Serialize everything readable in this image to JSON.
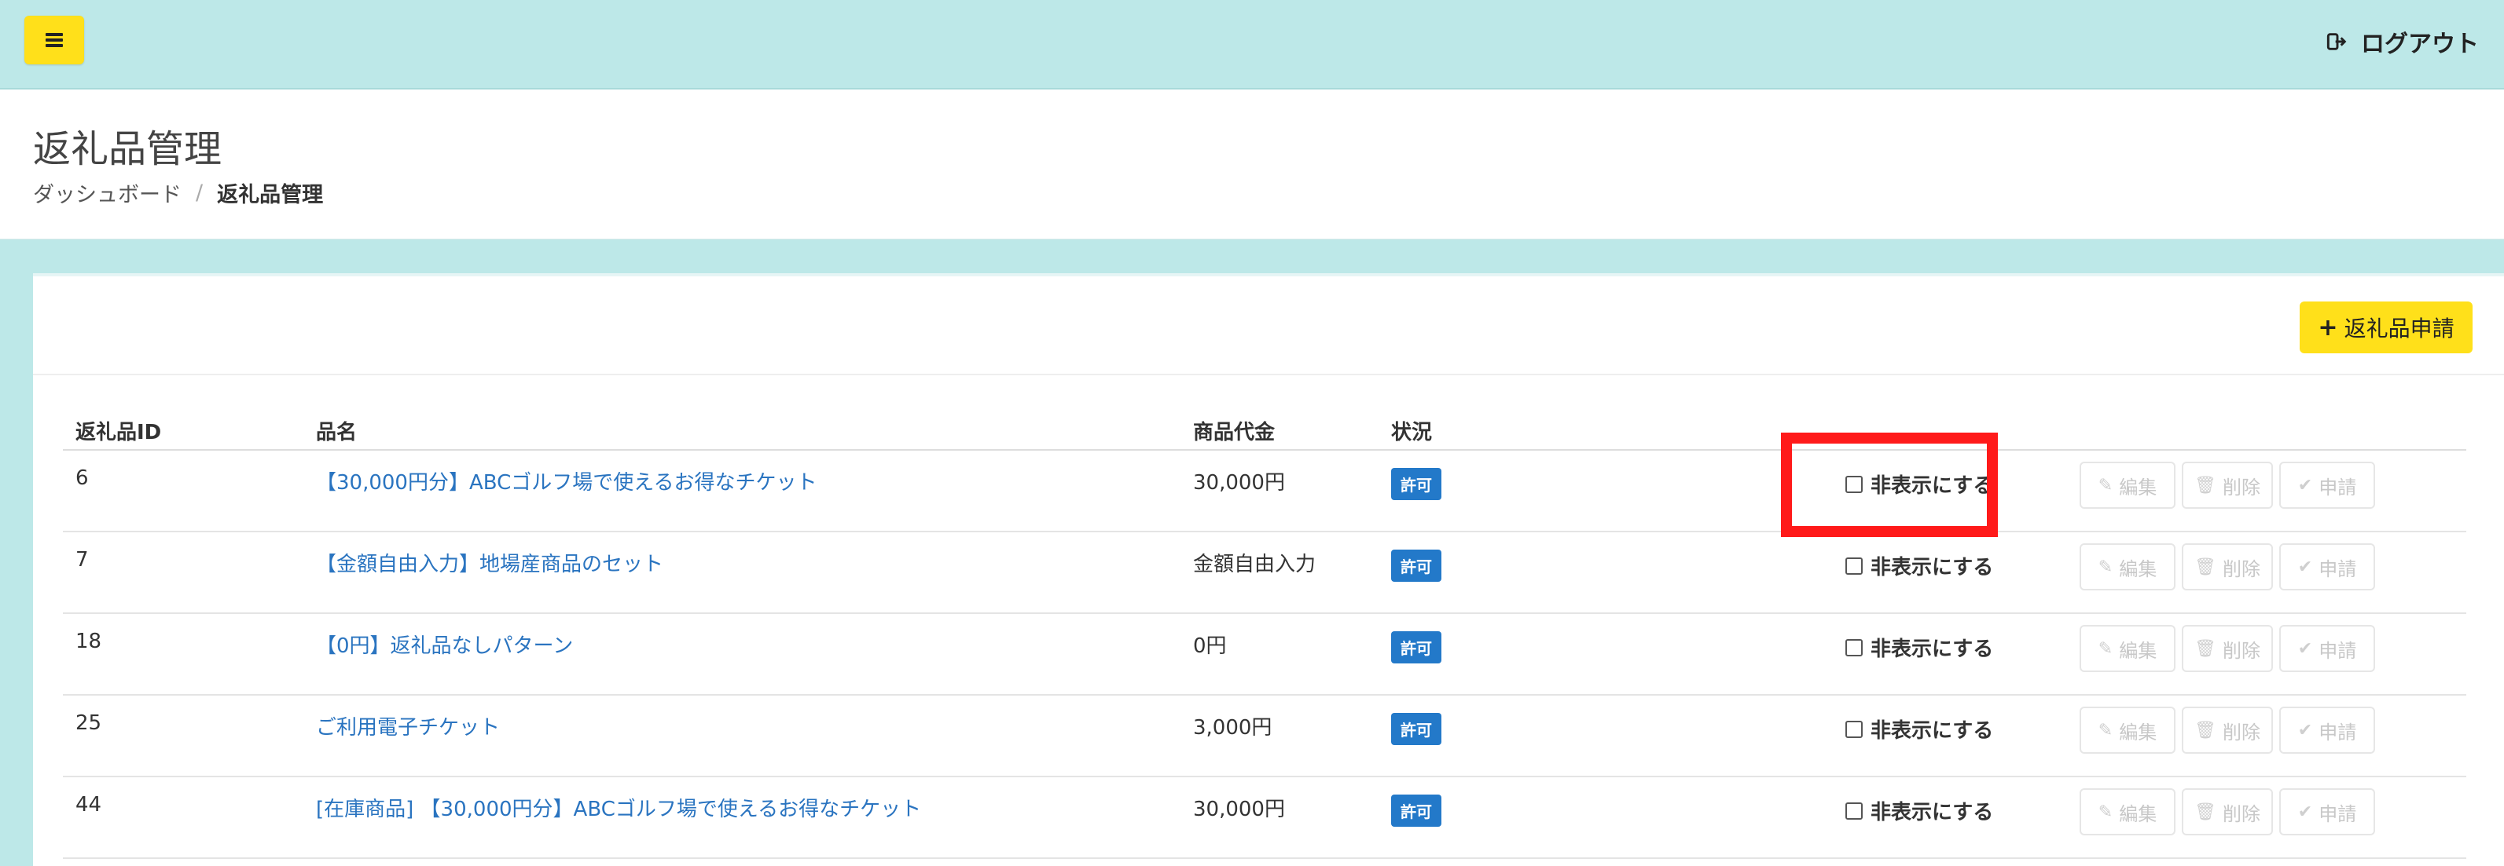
{
  "header": {
    "logout_label": "ログアウト"
  },
  "page": {
    "title": "返礼品管理",
    "breadcrumb": [
      "ダッシュボード",
      "返礼品管理"
    ]
  },
  "actions": {
    "apply_label": "返礼品申請"
  },
  "table": {
    "columns": [
      "返礼品ID",
      "品名",
      "商品代金",
      "状況"
    ],
    "rows": [
      {
        "id": "6",
        "name": "【30,000円分】ABCゴルフ場で使えるお得なチケット",
        "price": "30,000円",
        "status": "許可"
      },
      {
        "id": "7",
        "name": "【金額自由入力】地場産商品のセット",
        "price": "金額自由入力",
        "status": "許可"
      },
      {
        "id": "18",
        "name": "【0円】返礼品なしパターン",
        "price": "0円",
        "status": "許可"
      },
      {
        "id": "25",
        "name": "ご利用電子チケット",
        "price": "3,000円",
        "status": "許可"
      },
      {
        "id": "44",
        "name": "[在庫商品] 【30,000円分】ABCゴルフ場で使えるお得なチケット",
        "price": "30,000円",
        "status": "許可"
      }
    ],
    "hide_label": "非表示にする",
    "edit_label": "編集",
    "delete_label": "削除",
    "submit_label": "申請"
  },
  "colors": {
    "background": "#bde8e8",
    "accent": "#ffe01a",
    "link": "#2a74c0",
    "badge": "#2379c9",
    "highlight": "#ff1a1a"
  }
}
